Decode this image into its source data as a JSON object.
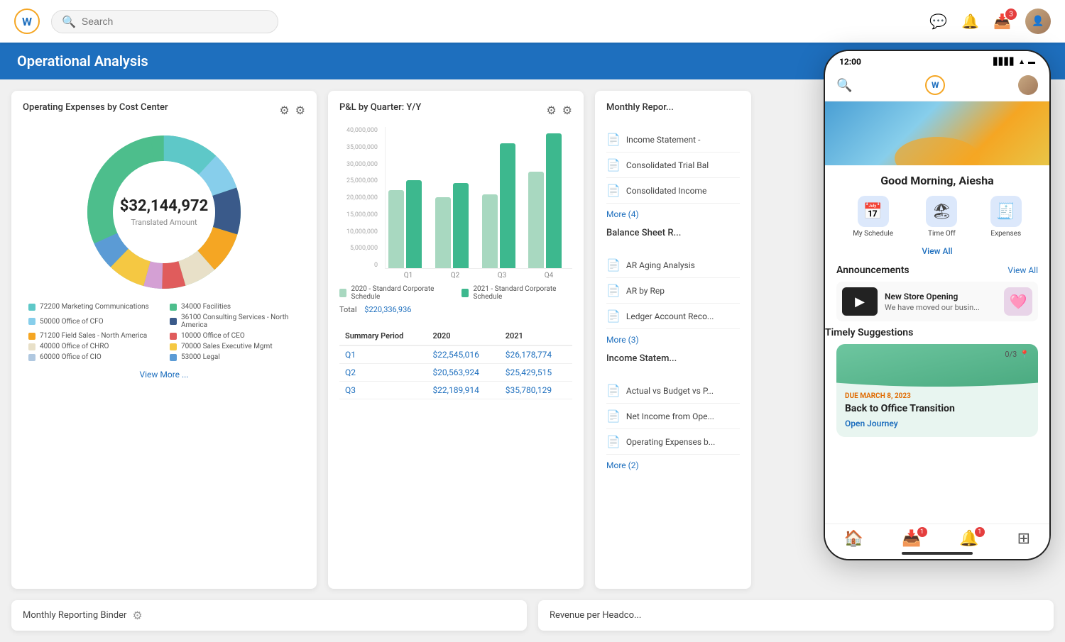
{
  "app": {
    "logo_letter": "W",
    "search_placeholder": "Search",
    "page_title": "Operational Analysis"
  },
  "nav": {
    "time": "12:00",
    "badge_count": "3"
  },
  "donut_card": {
    "title": "Operating Expenses by Cost Center",
    "amount": "$32,144,972",
    "subtitle": "Translated Amount",
    "view_more": "View More ...",
    "segments": [
      {
        "color": "#5ec8c8",
        "label": "72200 Marketing Communications",
        "pct": 12
      },
      {
        "color": "#87ceeb",
        "label": "50000 Office of CFO",
        "pct": 8
      },
      {
        "color": "#3a5a8a",
        "label": "36100 Consulting Services - North America",
        "pct": 10
      },
      {
        "color": "#f5a623",
        "label": "71200 Field Sales - North America",
        "pct": 9
      },
      {
        "color": "#e8e0c8",
        "label": "40000 Office of CHRO",
        "pct": 7
      },
      {
        "color": "#b0c8e0",
        "label": "60000 Office of CIO",
        "pct": 6
      },
      {
        "color": "#e05c5c",
        "label": "10000 Office of CEO",
        "pct": 5
      },
      {
        "color": "#f5a623",
        "label": "70000 Sales Executive Mgmt",
        "pct": 8
      },
      {
        "color": "#5b9bd5",
        "label": "53000 Legal",
        "pct": 6
      },
      {
        "color": "#4dbe8c",
        "label": "34000 Facilities",
        "pct": 29
      }
    ]
  },
  "bar_card": {
    "title": "P&L by Quarter: Y/Y",
    "y_labels": [
      "40,000,000",
      "35,000,000",
      "30,000,000",
      "25,000,000",
      "20,000,000",
      "15,000,000",
      "10,000,000",
      "5,000,000",
      "0"
    ],
    "x_labels": [
      "Q1",
      "Q2",
      "Q3",
      "Q4"
    ],
    "bars": [
      {
        "q": "Q1",
        "v2020": 55,
        "v2021": 62
      },
      {
        "q": "Q2",
        "v2020": 50,
        "v2021": 60
      },
      {
        "q": "Q3",
        "v2020": 52,
        "v2021": 88
      },
      {
        "q": "Q4",
        "v2020": 68,
        "v2021": 95
      }
    ],
    "color2020": "#a8d8c0",
    "color2021": "#3db88e",
    "legend2020": "2020 - Standard Corporate Schedule",
    "legend2021": "2021 - Standard Corporate Schedule",
    "total_label": "Total",
    "total_value": "$220,336,936",
    "table": {
      "headers": [
        "Summary Period",
        "2020",
        "2021"
      ],
      "rows": [
        {
          "period": "Q1",
          "v2020": "$22,545,016",
          "v2021": "$26,178,774"
        },
        {
          "period": "Q2",
          "v2020": "$20,563,924",
          "v2021": "$25,429,515"
        },
        {
          "period": "Q3",
          "v2020": "$22,189,914",
          "v2021": "$35,780,129"
        }
      ]
    }
  },
  "reports_card": {
    "title": "Monthly Repor...",
    "items": [
      "Income Statement -",
      "Consolidated Trial Bal",
      "Consolidated Income",
      "More (4)"
    ],
    "section2_title": "Balance Sheet R...",
    "section2_items": [
      "AR Aging Analysis",
      "AR by Rep",
      "Ledger Account Reco...",
      "More (3)"
    ],
    "section3_title": "Income Statem...",
    "section3_items": [
      "Actual vs Budget vs P...",
      "Net Income from Ope...",
      "Operating Expenses b...",
      "More (2)"
    ]
  },
  "mobile": {
    "time": "12:00",
    "greeting": "Good Morning, Aiesha",
    "quick_actions": [
      {
        "icon": "📅",
        "label": "My Schedule",
        "bg": "#e8f0fb"
      },
      {
        "icon": "🏖",
        "label": "Time Off",
        "bg": "#e8f0fb"
      },
      {
        "icon": "🧾",
        "label": "Expenses",
        "bg": "#e8f0fb"
      }
    ],
    "view_all": "View All",
    "announcements_title": "Announcements",
    "announcements_view_all": "View All",
    "announcement": {
      "title": "New Store Opening",
      "description": "We have moved our busin..."
    },
    "timely_title": "Timely Suggestions",
    "timely_badge": "0/3",
    "timely_due": "DUE MARCH 8, 2023",
    "timely_card_title": "Back to Office Transition",
    "timely_action": "Open Journey"
  },
  "bottom": {
    "monthly_binder": "Monthly Reporting Binder",
    "revenue": "Revenue per Headco..."
  }
}
